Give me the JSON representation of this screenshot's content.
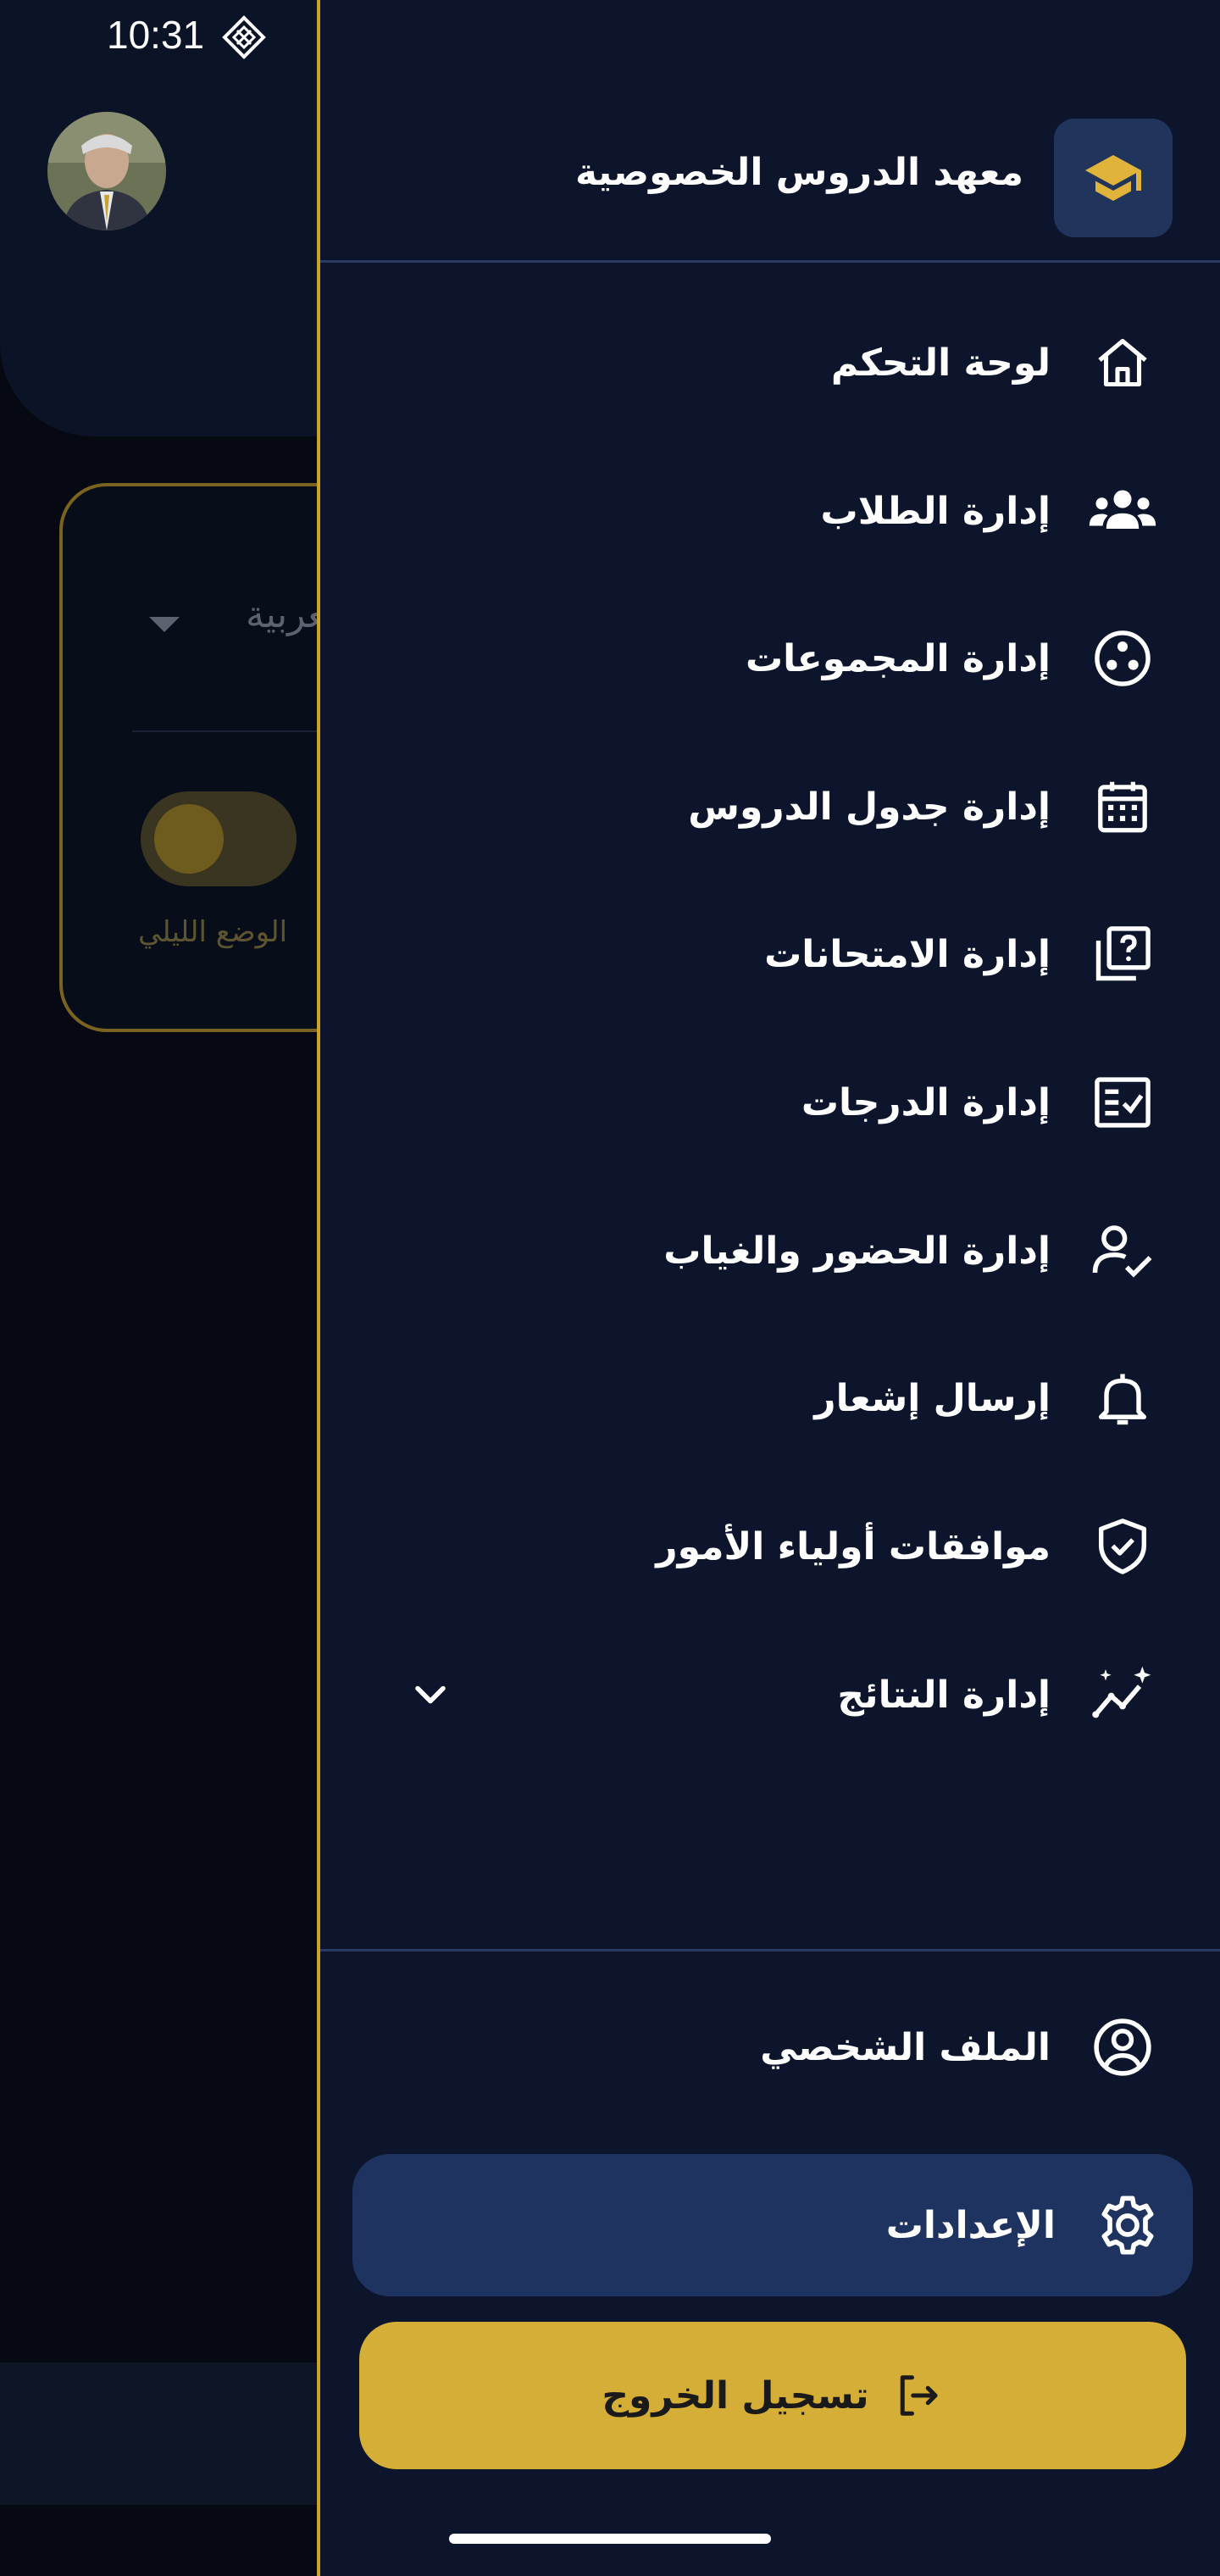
{
  "status_bar": {
    "time": "10:31"
  },
  "background": {
    "language_value": "العربية",
    "night_mode_label": "الوضع الليلي"
  },
  "drawer": {
    "title": "معهد الدروس الخصوصية",
    "logo_icon": "graduation-cap-icon",
    "items": [
      {
        "label": "لوحة التحكم",
        "icon": "home-icon"
      },
      {
        "label": "إدارة الطلاب",
        "icon": "users-icon"
      },
      {
        "label": "إدارة المجموعات",
        "icon": "groups-icon"
      },
      {
        "label": "إدارة جدول الدروس",
        "icon": "calendar-icon"
      },
      {
        "label": "إدارة الامتحانات",
        "icon": "quiz-icon"
      },
      {
        "label": "إدارة الدرجات",
        "icon": "grades-icon"
      },
      {
        "label": "إدارة الحضور والغياب",
        "icon": "attendance-icon"
      },
      {
        "label": "إرسال إشعار",
        "icon": "bell-icon"
      },
      {
        "label": "موافقات أولياء الأمور",
        "icon": "shield-check-icon"
      },
      {
        "label": "إدارة النتائج",
        "icon": "results-icon",
        "expandable": true
      }
    ],
    "profile_label": "الملف الشخصي",
    "settings_label": "الإعدادات",
    "logout_label": "تسجيل الخروج"
  },
  "colors": {
    "drawer_bg": "#0c152b",
    "accent_gold": "#d4ae36",
    "selected_item_bg": "#1f3360",
    "page_bg": "#060912"
  }
}
